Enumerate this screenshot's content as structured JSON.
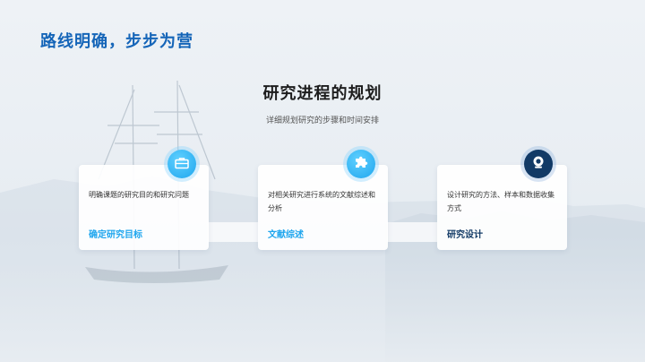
{
  "header": {
    "title": "路线明确，步步为营"
  },
  "section": {
    "title": "研究进程的规划",
    "subtitle": "详细规划研究的步骤和时间安排"
  },
  "steps": [
    {
      "description": "明确课题的研究目的和研究问题",
      "label": "确定研究目标",
      "icon": "briefcase-icon",
      "accent": "#1fa6ee"
    },
    {
      "description": "对相关研究进行系统的文献综述和分析",
      "label": "文献综述",
      "icon": "puzzle-icon",
      "accent": "#1fa6ee"
    },
    {
      "description": "设计研究的方法、样本和数据收集方式",
      "label": "研究设计",
      "icon": "camera-icon",
      "accent": "#123a66"
    }
  ]
}
